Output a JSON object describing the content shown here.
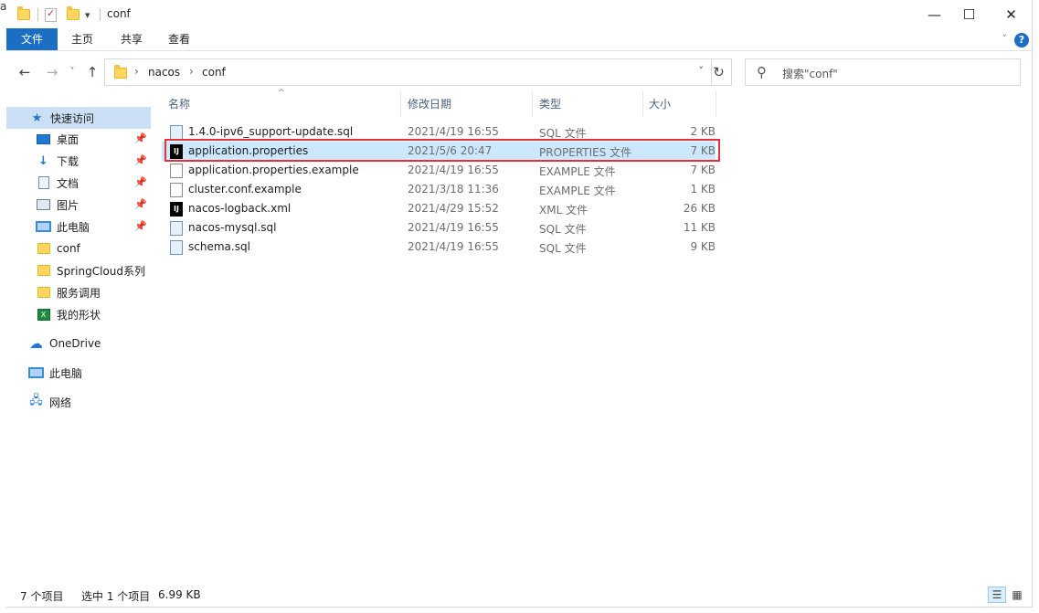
{
  "titlebar": {
    "partial_text": "al",
    "title": "conf",
    "dropdown_glyph": "▾",
    "minimize": "—",
    "maximize": "☐",
    "close": "✕"
  },
  "ribbon": {
    "tabs": [
      "文件",
      "主页",
      "共享",
      "查看"
    ],
    "collapse_glyph": "˅",
    "help_glyph": "?"
  },
  "nav": {
    "back": "←",
    "forward": "→",
    "recent": "˅",
    "up": "↑",
    "breadcrumb": [
      "nacos",
      "conf"
    ],
    "breadcrumb_sep": "›",
    "dropdown": "˅",
    "refresh": "↻"
  },
  "search": {
    "placeholder": "搜索\"conf\"",
    "icon": "⚲"
  },
  "sidebar": {
    "pin_glyph": "📌",
    "items": [
      {
        "label": "快速访问",
        "icon": "star-icon",
        "glyph": "★",
        "selected": true,
        "pinned": false
      },
      {
        "label": "桌面",
        "icon": "desktop-icon",
        "selected": false,
        "pinned": true
      },
      {
        "label": "下载",
        "icon": "download-icon",
        "glyph": "↓",
        "selected": false,
        "pinned": true
      },
      {
        "label": "文档",
        "icon": "document-icon",
        "selected": false,
        "pinned": true
      },
      {
        "label": "图片",
        "icon": "pictures-icon",
        "selected": false,
        "pinned": true
      },
      {
        "label": "此电脑",
        "icon": "computer-icon",
        "selected": false,
        "pinned": true
      },
      {
        "label": "conf",
        "icon": "folder-icon",
        "selected": false,
        "pinned": false
      },
      {
        "label": "SpringCloud系列",
        "icon": "folder-icon",
        "selected": false,
        "pinned": false
      },
      {
        "label": "服务调用",
        "icon": "folder-icon",
        "selected": false,
        "pinned": false
      },
      {
        "label": "我的形状",
        "icon": "excel-icon",
        "glyph": "X",
        "selected": false,
        "pinned": false
      },
      {
        "label": "OneDrive",
        "icon": "cloud-icon",
        "glyph": "☁",
        "selected": false,
        "pinned": false
      },
      {
        "label": "此电脑",
        "icon": "computer-icon",
        "selected": false,
        "pinned": false
      },
      {
        "label": "网络",
        "icon": "network-icon",
        "glyph": "🖧",
        "selected": false,
        "pinned": false
      }
    ]
  },
  "filelist": {
    "columns": [
      "名称",
      "修改日期",
      "类型",
      "大小"
    ],
    "sort_glyph": "^",
    "files": [
      {
        "name": "1.4.0-ipv6_support-update.sql",
        "date": "2021/4/19 16:55",
        "type": "SQL 文件",
        "size": "2 KB",
        "icon": "sql",
        "selected": false
      },
      {
        "name": "application.properties",
        "date": "2021/5/6 20:47",
        "type": "PROPERTIES 文件",
        "size": "7 KB",
        "icon": "idea",
        "selected": true
      },
      {
        "name": "application.properties.example",
        "date": "2021/4/19 16:55",
        "type": "EXAMPLE 文件",
        "size": "7 KB",
        "icon": "blank",
        "selected": false
      },
      {
        "name": "cluster.conf.example",
        "date": "2021/3/18 11:36",
        "type": "EXAMPLE 文件",
        "size": "1 KB",
        "icon": "blank",
        "selected": false
      },
      {
        "name": "nacos-logback.xml",
        "date": "2021/4/29 15:52",
        "type": "XML 文件",
        "size": "26 KB",
        "icon": "idea",
        "selected": false
      },
      {
        "name": "nacos-mysql.sql",
        "date": "2021/4/19 16:55",
        "type": "SQL 文件",
        "size": "11 KB",
        "icon": "sql",
        "selected": false
      },
      {
        "name": "schema.sql",
        "date": "2021/4/19 16:55",
        "type": "SQL 文件",
        "size": "9 KB",
        "icon": "sql",
        "selected": false
      }
    ],
    "idea_glyph": "IJ"
  },
  "status": {
    "item_count": "7 个项目",
    "selection": "选中 1 个项目",
    "selection_size": "6.99 KB",
    "details_view_glyph": "☰",
    "large_icons_glyph": "▦"
  },
  "colors": {
    "accent": "#1a6fc4",
    "selection": "#cce8ff",
    "highlight_border": "#e0333a"
  }
}
